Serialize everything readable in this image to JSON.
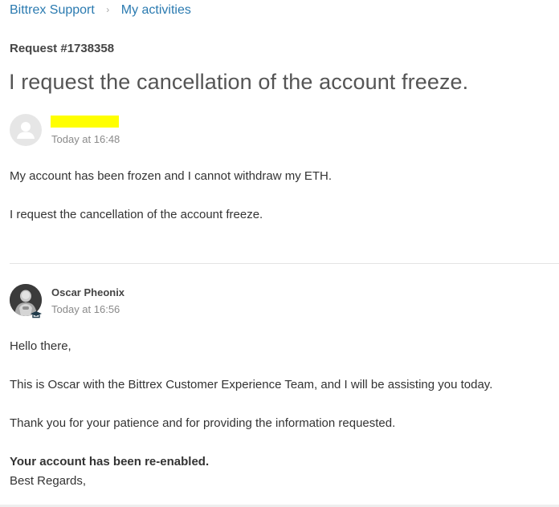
{
  "breadcrumb": {
    "items": [
      "Bittrex Support",
      "My activities"
    ],
    "separator": "›"
  },
  "request": {
    "id_label": "Request #1738358",
    "title": "I request the cancellation of the account freeze."
  },
  "comments": [
    {
      "author": "",
      "author_redacted": true,
      "time": "Today at 16:48",
      "paragraphs": [
        "My account has been frozen and I cannot withdraw my ETH.",
        "I request the cancellation of the account freeze."
      ]
    },
    {
      "author": "Oscar Pheonix",
      "time": "Today at 16:56",
      "paragraphs": [
        "Hello there,",
        "This is Oscar with the Bittrex Customer Experience Team, and I will be assisting you today.",
        "Thank you for your patience and for providing the information requested.",
        "Your account has been re-enabled.",
        "Best Regards,"
      ]
    }
  ],
  "icons": {
    "anonymous_avatar": "user-silhouette-icon",
    "agent_avatar": "agent-photo-avatar",
    "agent_badge": "agent-badge-icon"
  },
  "colors": {
    "link": "#2a7ab0",
    "redaction": "#ffff00",
    "muted": "#8a8a8a"
  }
}
